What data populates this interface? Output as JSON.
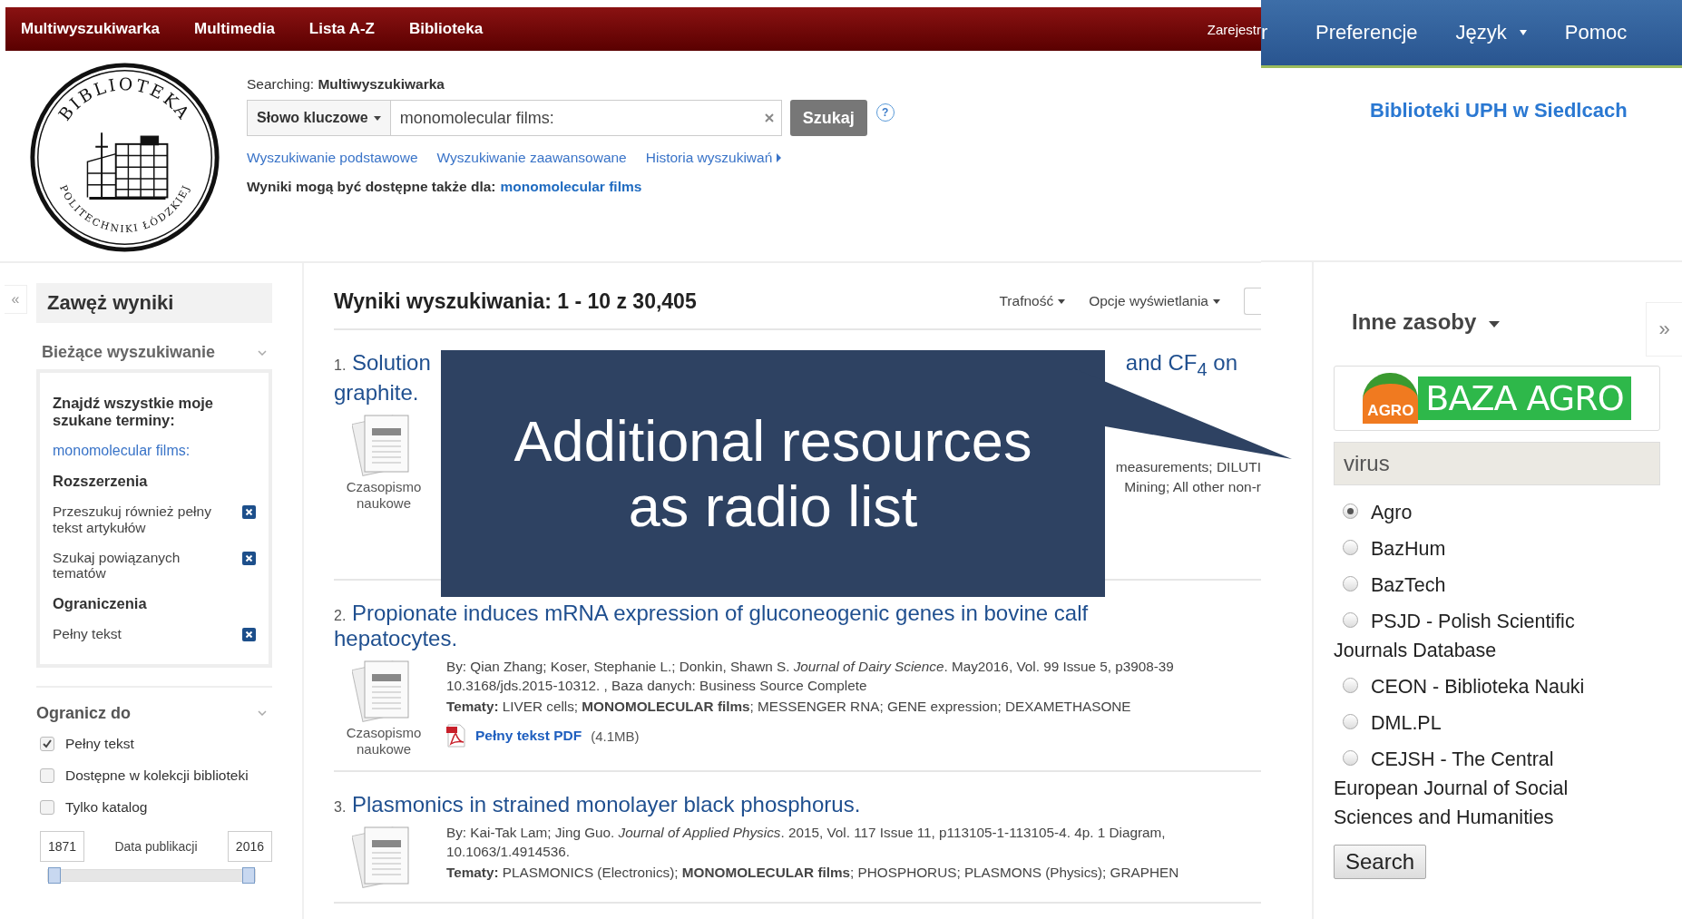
{
  "top_nav": {
    "items": [
      "Multiwyszukiwarka",
      "Multimedia",
      "Lista A-Z",
      "Biblioteka"
    ],
    "cut_item": "Zarejestr"
  },
  "logo": {
    "top_text": "BIBLIOTEKA",
    "bottom_text": "POLITECHNIKI ŁÓDZKIEJ"
  },
  "search": {
    "searching_label": "Searching:",
    "searching_value": "Multiwyszukiwarka",
    "field_selector": "Słowo kluczowe",
    "query": "monomolecular films:",
    "button": "Szukaj",
    "help": "?",
    "links": [
      "Wyszukiwanie podstawowe",
      "Wyszukiwanie zaawansowane",
      "Historia wyszukiwań"
    ],
    "also_label": "Wyniki mogą być dostępne także dla:",
    "also_link": "monomolecular films"
  },
  "sidebar": {
    "collapse": "«",
    "title": "Zawęż wyniki",
    "current": {
      "heading": "Bieżące wyszukiwanie",
      "find_all": "Znajdź wszystkie moje szukane terminy:",
      "term": "monomolecular films:",
      "expanders_heading": "Rozszerzenia",
      "expanders": [
        "Przeszukuj również pełny tekst artykułów",
        "Szukaj powiązanych tematów"
      ],
      "limiters_heading": "Ograniczenia",
      "limiters": [
        "Pełny tekst"
      ]
    },
    "limit_to": {
      "heading": "Ogranicz do",
      "options": [
        {
          "label": "Pełny tekst",
          "checked": true
        },
        {
          "label": "Dostępne w kolekcji biblioteki",
          "checked": false
        },
        {
          "label": "Tylko katalog",
          "checked": false
        }
      ],
      "date_from": "1871",
      "date_label": "Data publikacji",
      "date_to": "2016",
      "level": 1
    }
  },
  "results": {
    "heading": "Wyniki wyszukiwania: 1 - 10 z 30,405",
    "sort": "Trafność",
    "display_options": "Opcje wyświetlania",
    "items": [
      {
        "kind": "covered",
        "number": "1.",
        "title_start": "Solution",
        "title_end": "and CF$_{4}$ on",
        "title_line2": "graphite.",
        "type": "Czasopismo naukowe",
        "fragments": [
          "measurements; DILUTI",
          "Mining; All other non-r"
        ]
      },
      {
        "kind": "full",
        "number": "2.",
        "title": "Propionate induces mRNA expression of gluconeogenic genes in bovine calf hepatocytes.",
        "byline": "By: Qian Zhang; Koser, Stephanie L.; Donkin, Shawn S. *Journal of Dairy Science*. May2016, Vol. 99 Issue 5, p3908-39",
        "byline2": "10.3168/jds.2015-10312. , Baza danych: Business Source Complete",
        "subjects": "**Tematy:** LIVER cells; **MONOMOLECULAR films**; MESSENGER RNA; GENE expression; DEXAMETHASONE",
        "type": "Czasopismo naukowe",
        "pdf_link": "Pełny tekst PDF",
        "pdf_size": "(4.1MB)"
      },
      {
        "kind": "full",
        "number": "3.",
        "title": "Plasmonics in strained monolayer black phosphorus.",
        "byline": "By: Kai-Tak Lam; Jing Guo. *Journal of Applied Physics*. 2015, Vol. 117 Issue 11, p113105-1-113105-4. 4p. 1 Diagram,",
        "byline2": "10.1063/1.4914536.",
        "subjects": "**Tematy:** PLASMONICS (Electronics); **MONOMOLECULAR films**; PHOSPHORUS; PLASMONS (Physics); GRAPHEN"
      }
    ]
  },
  "right_panel": {
    "cut_item": "r",
    "nav": [
      {
        "label": "Preferencje",
        "has_menu": false
      },
      {
        "label": "Język",
        "has_menu": true
      },
      {
        "label": "Pomoc",
        "has_menu": false
      }
    ],
    "library_link": "Biblioteki UPH w Siedlcach",
    "expand": "»",
    "other_resources": "Inne zasoby",
    "resource_logo": {
      "badge": "AGRO",
      "name": "BAZA AGRO"
    },
    "query": "virus",
    "sources": [
      {
        "label": "Agro",
        "selected": true
      },
      {
        "label": "BazHum",
        "selected": false
      },
      {
        "label": "BazTech",
        "selected": false
      },
      {
        "label": "PSJD - Polish Scientific Journals Database",
        "selected": false
      },
      {
        "label": "CEON - Biblioteka Nauki",
        "selected": false
      },
      {
        "label": "DML.PL",
        "selected": false
      },
      {
        "label": "CEJSH - The Central European Journal of Social Sciences and Humanities",
        "selected": false
      }
    ],
    "search_button": "Search"
  },
  "callout": {
    "text": "Additional resources as radio list"
  }
}
